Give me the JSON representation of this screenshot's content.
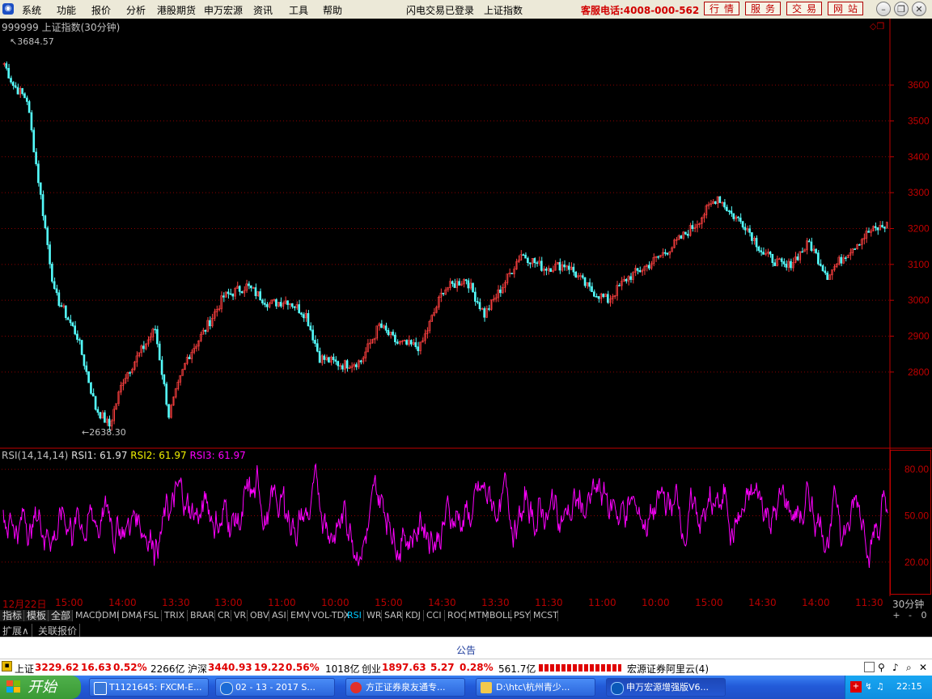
{
  "menu": {
    "items": [
      "系统",
      "功能",
      "报价",
      "分析",
      "港股期货",
      "申万宏源",
      "资讯",
      "工具",
      "帮助"
    ],
    "status": "闪电交易已登录",
    "index_name": "上证指数",
    "service_phone": "客服电话:4008-000-562",
    "quick_buttons": [
      "行情",
      "服务",
      "交易",
      "网站"
    ]
  },
  "chart": {
    "title": "999999 上证指数(30分钟)",
    "high_label": "3684.57",
    "low_label": "2638.30",
    "rsi_label": "RSI(14,14,14)",
    "rsi1": "RSI1: 61.97",
    "rsi2": "RSI2: 61.97",
    "rsi3": "RSI3: 61.97",
    "period": "30分钟",
    "time_ticks": [
      "12月22日",
      "15:00",
      "14:00",
      "13:30",
      "13:00",
      "11:00",
      "10:00",
      "15:00",
      "14:30",
      "13:30",
      "11:30",
      "11:00",
      "10:00",
      "15:00",
      "14:30",
      "14:00",
      "11:30"
    ]
  },
  "chart_data": [
    {
      "type": "candlestick",
      "title": "999999 上证指数(30分钟)",
      "y_ticks": [
        2800,
        2900,
        3000,
        3100,
        3200,
        3300,
        3400,
        3500,
        3600
      ],
      "ylim": [
        2590,
        3740
      ],
      "high": 3684.57,
      "low": 2638.3,
      "close_path": [
        {
          "i": 0,
          "v": 3660
        },
        {
          "i": 4,
          "v": 3600
        },
        {
          "i": 10,
          "v": 3560
        },
        {
          "i": 14,
          "v": 3380
        },
        {
          "i": 22,
          "v": 3020
        },
        {
          "i": 32,
          "v": 2900
        },
        {
          "i": 40,
          "v": 2700
        },
        {
          "i": 46,
          "v": 2650
        },
        {
          "i": 52,
          "v": 2780
        },
        {
          "i": 60,
          "v": 2860
        },
        {
          "i": 66,
          "v": 2920
        },
        {
          "i": 72,
          "v": 2680
        },
        {
          "i": 80,
          "v": 2840
        },
        {
          "i": 88,
          "v": 2920
        },
        {
          "i": 96,
          "v": 3010
        },
        {
          "i": 106,
          "v": 3040
        },
        {
          "i": 116,
          "v": 2990
        },
        {
          "i": 124,
          "v": 3000
        },
        {
          "i": 132,
          "v": 2960
        },
        {
          "i": 138,
          "v": 2840
        },
        {
          "i": 148,
          "v": 2820
        },
        {
          "i": 156,
          "v": 2830
        },
        {
          "i": 164,
          "v": 2930
        },
        {
          "i": 172,
          "v": 2880
        },
        {
          "i": 182,
          "v": 2870
        },
        {
          "i": 192,
          "v": 3030
        },
        {
          "i": 202,
          "v": 3060
        },
        {
          "i": 210,
          "v": 2960
        },
        {
          "i": 218,
          "v": 3040
        },
        {
          "i": 226,
          "v": 3130
        },
        {
          "i": 236,
          "v": 3090
        },
        {
          "i": 246,
          "v": 3100
        },
        {
          "i": 256,
          "v": 3030
        },
        {
          "i": 264,
          "v": 3000
        },
        {
          "i": 272,
          "v": 3060
        },
        {
          "i": 282,
          "v": 3100
        },
        {
          "i": 292,
          "v": 3150
        },
        {
          "i": 302,
          "v": 3210
        },
        {
          "i": 312,
          "v": 3290
        },
        {
          "i": 318,
          "v": 3240
        },
        {
          "i": 324,
          "v": 3210
        },
        {
          "i": 332,
          "v": 3130
        },
        {
          "i": 342,
          "v": 3090
        },
        {
          "i": 352,
          "v": 3160
        },
        {
          "i": 360,
          "v": 3070
        },
        {
          "i": 368,
          "v": 3130
        },
        {
          "i": 378,
          "v": 3190
        },
        {
          "i": 386,
          "v": 3210
        }
      ],
      "n_bars": 387
    },
    {
      "type": "line",
      "title": "RSI(14,14,14)",
      "y_ticks": [
        20.0,
        50.0,
        80.0
      ],
      "ylim": [
        0,
        90
      ],
      "series": [
        {
          "name": "RSI1",
          "last": 61.97
        },
        {
          "name": "RSI2",
          "last": 61.97
        },
        {
          "name": "RSI3",
          "last": 61.97
        }
      ]
    }
  ],
  "indicator_tabs": [
    "指标",
    "模板",
    "全部",
    "MACD",
    "DMI",
    "DMA",
    "FSL",
    "TRIX",
    "BRAR",
    "CR",
    "VR",
    "OBV",
    "ASI",
    "EMV",
    "VOL-TDX",
    "RSI",
    "WR",
    "SAR",
    "KDJ",
    "CCI",
    "ROC",
    "MTM",
    "BOLL",
    "PSY",
    "MCST"
  ],
  "active_indicator": "RSI",
  "zoom": [
    "+",
    "-",
    "0"
  ],
  "ext_tabs": [
    "扩展∧",
    "关联报价"
  ],
  "notice": "公告",
  "status": {
    "sh_label": "上证",
    "sh_value": "3229.62",
    "sh_change": "16.63",
    "sh_pct": "0.52%",
    "sh_amount": "2266亿",
    "hs_label": "沪深",
    "hs_value": "3440.93",
    "hs_change": "19.22",
    "hs_pct": "0.56%",
    "hs_amount": "1018亿",
    "cy_label": "创业",
    "cy_value": "1897.63",
    "cy_change": "5.27",
    "cy_pct": "0.28%",
    "cy_amount": "561.7亿",
    "broker": "宏源证券阿里云(4)"
  },
  "taskbar": {
    "start": "开始",
    "items": [
      "T1121645: FXCM-E...",
      "02 - 13 - 2017 S...",
      "方正证券泉友通专...",
      "D:\\htc\\杭州青少...",
      "申万宏源增强版V6..."
    ],
    "clock": "22:15"
  },
  "colors": {
    "up": "#ff4040",
    "down": "#54fcfc",
    "rsi": "#ff00ff",
    "grid": "#8b0000",
    "axis": "#c00000"
  }
}
